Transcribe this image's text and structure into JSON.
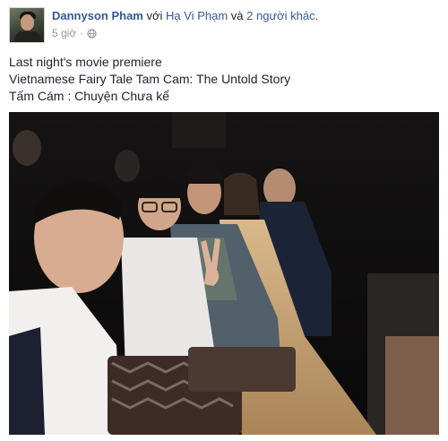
{
  "post": {
    "author": "Dannyson Pham",
    "with_text": "với",
    "tagged_person": "Hạ Vi Phạm",
    "others_connector": "và",
    "others_text": "2 người khác.",
    "timestamp": "5 giờ",
    "separator": "·",
    "privacy_icon": "globe-icon",
    "lines": [
      "Last night's movie premiere",
      "Vietnamese Fairy Tale Tam Cam: The Untold Story",
      "Tấm Cám : Chuyện Chưa kể"
    ]
  },
  "colors": {
    "link": "#365899",
    "meta": "#90949c",
    "text": "#1d2129"
  }
}
